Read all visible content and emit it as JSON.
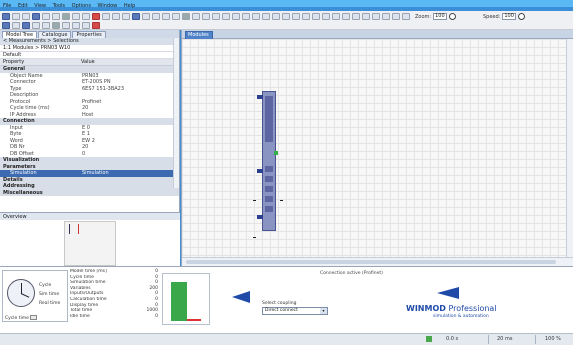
{
  "menu": [
    "File",
    "Edit",
    "View",
    "Tools",
    "Options",
    "Window",
    "Help"
  ],
  "toolbar": {
    "zoom_label": "Zoom:",
    "zoom_value": "100",
    "speed_label": "Speed:",
    "speed_value": "100"
  },
  "left_panel": {
    "tabs": [
      "Model Tree",
      "Catalogue",
      "Properties"
    ],
    "line1": "< Measurements > Selections",
    "line2": "1:1 Modules > PRN03 W10",
    "filter": "Default",
    "props_header": [
      "Property",
      "Value"
    ],
    "rows": [
      {
        "type": "cat",
        "k": "General",
        "v": ""
      },
      {
        "type": "row",
        "k": "Object Name",
        "v": "PRN03"
      },
      {
        "type": "row",
        "k": "Connector",
        "v": "ET-200S PN"
      },
      {
        "type": "row",
        "k": "Type",
        "v": "6ES7 151-3BA23"
      },
      {
        "type": "row",
        "k": "Description",
        "v": ""
      },
      {
        "type": "row",
        "k": "Protocol",
        "v": "Profinet"
      },
      {
        "type": "row",
        "k": "Cycle time (ms)",
        "v": "20"
      },
      {
        "type": "row",
        "k": "IP Address",
        "v": "Host"
      },
      {
        "type": "cat",
        "k": "Connection",
        "v": ""
      },
      {
        "type": "row",
        "k": "Input",
        "v": "E 0"
      },
      {
        "type": "row",
        "k": "Byte",
        "v": "E 1"
      },
      {
        "type": "row",
        "k": "Word",
        "v": "EW 2"
      },
      {
        "type": "row",
        "k": "DB Nr",
        "v": "20"
      },
      {
        "type": "row",
        "k": "DB Offset",
        "v": "0"
      },
      {
        "type": "cat",
        "k": "Visualization",
        "v": ""
      },
      {
        "type": "cat",
        "k": "Parameters",
        "v": ""
      },
      {
        "type": "sel",
        "k": "Simulation",
        "v": "Simulation"
      },
      {
        "type": "cat",
        "k": "Details",
        "v": ""
      },
      {
        "type": "cat",
        "k": "Addressing",
        "v": ""
      },
      {
        "type": "cat",
        "k": "Miscellaneous",
        "v": ""
      }
    ]
  },
  "miniview": {
    "title": "Overview"
  },
  "editor": {
    "tab": "Modules"
  },
  "bottom": {
    "clock_labels": [
      "Cycle",
      "Sim time",
      "Real time"
    ],
    "clock_bottom": "Cycle time",
    "stats": [
      {
        "k": "Model time [ms]",
        "v": "0"
      },
      {
        "k": "Cycle time",
        "v": "0"
      },
      {
        "k": "Simulation time",
        "v": "0"
      },
      {
        "k": "Variables",
        "v": "200"
      },
      {
        "k": "Inputs/Outputs",
        "v": "0"
      },
      {
        "k": "Calculation time",
        "v": "0"
      },
      {
        "k": "Display time",
        "v": "0"
      },
      {
        "k": "Total time",
        "v": "1000"
      },
      {
        "k": "Idle time",
        "v": "0"
      }
    ],
    "gauge_fraction": 0.85,
    "top_status": "Connection active (Profinet)",
    "connect_label": "Select coupling",
    "connect_value": "Direct connect",
    "brand_bold": "WINMOD",
    "brand_light": " Professional",
    "brand_sub": "simulation & automation"
  },
  "statusbar": {
    "s1": "0.0 s",
    "s2": "20 ms",
    "s3": "100 %"
  },
  "colors": {
    "accent": "#1f4aa8",
    "selection": "#3c6ab0",
    "module": "#8a94c2"
  }
}
